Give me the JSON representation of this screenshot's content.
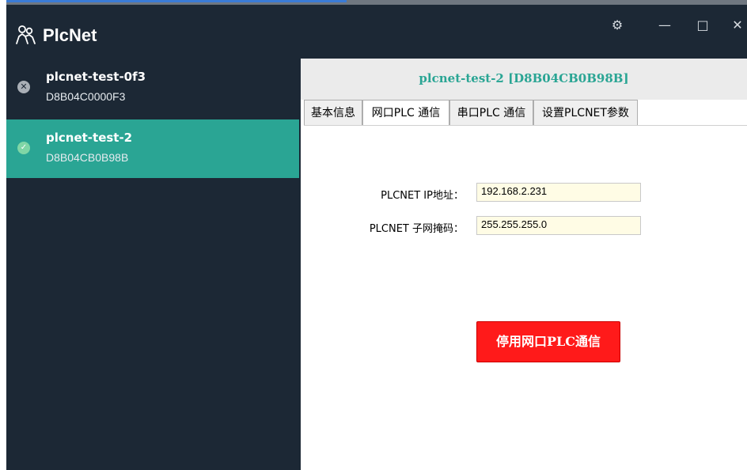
{
  "app": {
    "title": "PlcNet"
  },
  "window_controls": {
    "settings": "⚙",
    "minimize": "—",
    "maximize": "□",
    "close": "✕"
  },
  "devices": [
    {
      "name": "plcnet-test-0f3",
      "id": "D8B04C0000F3",
      "status": "offline",
      "status_glyph": "✕",
      "selected": false
    },
    {
      "name": "plcnet-test-2",
      "id": "D8B04CB0B98B",
      "status": "online",
      "status_glyph": "✓",
      "selected": true
    }
  ],
  "header": {
    "title": "plcnet-test-2  [D8B04CB0B98B]"
  },
  "tabs": [
    {
      "label": "基本信息",
      "active": false
    },
    {
      "label": "网口PLC 通信",
      "active": true
    },
    {
      "label": "串口PLC 通信",
      "active": false
    },
    {
      "label": "设置PLCNET参数",
      "active": false
    }
  ],
  "form": {
    "ip_label": "PLCNET IP地址：",
    "ip_value": "192.168.2.231",
    "mask_label": "PLCNET 子网掩码：",
    "mask_value": "255.255.255.0"
  },
  "actions": {
    "stop_label": "停用网口PLC通信"
  },
  "colors": {
    "sidebar_bg": "#1c2835",
    "selected_bg": "#2aa594",
    "accent_text": "#2aa594",
    "button_red": "#ff1a1a",
    "input_bg": "#fffce5"
  },
  "icons": {
    "logo": "people-icon",
    "settings": "gear-icon",
    "offline_status": "close-circle-icon",
    "online_status": "check-circle-icon"
  }
}
